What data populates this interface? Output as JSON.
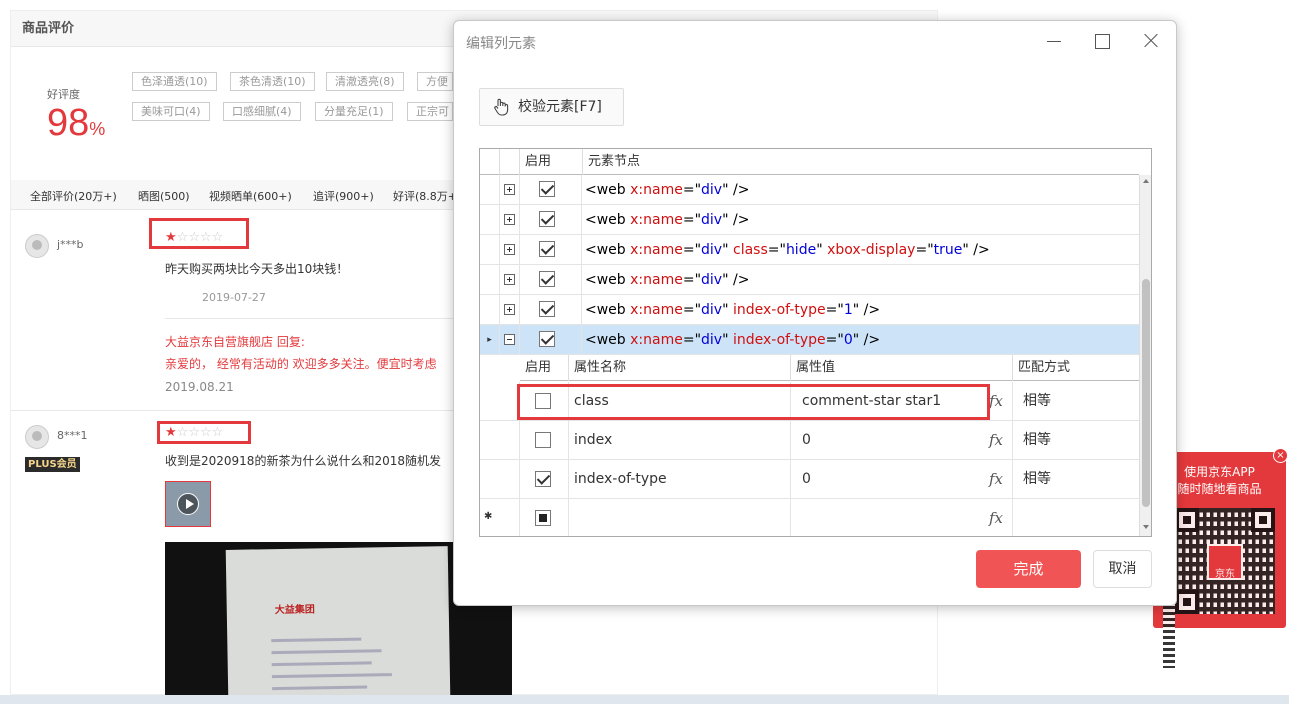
{
  "page": {
    "section_title": "商品评价",
    "good_rate_label": "好评度",
    "good_rate_value": "98",
    "good_rate_unit": "%",
    "tags": [
      "色泽通透(10)",
      "茶色清透(10)",
      "清澈透亮(8)",
      "方便",
      "美味可口(4)",
      "口感细腻(4)",
      "分量充足(1)",
      "正宗可"
    ],
    "filters": [
      "全部评价(20万+)",
      "晒图(500)",
      "视频晒单(600+)",
      "追评(900+)",
      "好评(8.8万+"
    ],
    "reviews": [
      {
        "user": "j***b",
        "stars": "★☆☆☆☆",
        "text": "昨天购买两块比今天多出10块钱！",
        "date": "2019-07-27",
        "reply_header": "大益京东自营旗舰店 回复:",
        "reply_text": "亲爱的， 经常有活动的 欢迎多多关注。便宜时考虑",
        "reply_date": "2019.08.21"
      },
      {
        "user": "8***1",
        "badge": "PLUS会员",
        "stars": "★☆☆☆☆",
        "text": "收到是2020918的新茶为什么说什么和2018随机发"
      }
    ],
    "video_brand": "大益集团"
  },
  "app_ad": {
    "line1": "使用京东APP",
    "line2": "随时随地看商品",
    "logo_text": "京东",
    "close_icon": "×"
  },
  "dialog": {
    "title": "编辑列元素",
    "verify_button": "校验元素[F7]",
    "grid": {
      "headers": {
        "enabled": "启用",
        "node": "元素节点"
      },
      "rows": [
        {
          "expand": "+",
          "checked": true,
          "selected": false,
          "current": false,
          "tag": "web",
          "attrs": [
            {
              "n": "x:name",
              "v": "div"
            }
          ]
        },
        {
          "expand": "+",
          "checked": true,
          "selected": false,
          "current": false,
          "tag": "web",
          "attrs": [
            {
              "n": "x:name",
              "v": "div"
            }
          ]
        },
        {
          "expand": "+",
          "checked": true,
          "selected": false,
          "current": false,
          "tag": "web",
          "attrs": [
            {
              "n": "x:name",
              "v": "div"
            },
            {
              "n": "class",
              "v": "hide"
            },
            {
              "n": "xbox-display",
              "v": "true"
            }
          ]
        },
        {
          "expand": "+",
          "checked": true,
          "selected": false,
          "current": false,
          "tag": "web",
          "attrs": [
            {
              "n": "x:name",
              "v": "div"
            }
          ]
        },
        {
          "expand": "+",
          "checked": true,
          "selected": false,
          "current": false,
          "tag": "web",
          "attrs": [
            {
              "n": "x:name",
              "v": "div"
            },
            {
              "n": "index-of-type",
              "v": "1"
            }
          ]
        },
        {
          "expand": "-",
          "checked": true,
          "selected": true,
          "current": true,
          "tag": "web",
          "attrs": [
            {
              "n": "x:name",
              "v": "div"
            },
            {
              "n": "index-of-type",
              "v": "0"
            }
          ]
        }
      ],
      "sub_headers": {
        "enabled": "启用",
        "attr_name": "属性名称",
        "attr_value": "属性值",
        "match": "匹配方式"
      },
      "sub_rows": [
        {
          "checked": false,
          "name": "class",
          "value": "comment-star star1",
          "fx": "fx",
          "match": "相等"
        },
        {
          "checked": false,
          "name": "index",
          "value": "0",
          "fx": "fx",
          "match": "相等"
        },
        {
          "checked": true,
          "name": "index-of-type",
          "value": "0",
          "fx": "fx",
          "match": "相等"
        },
        {
          "checked": "indeterminate",
          "name": "",
          "value": "",
          "fx": "fx",
          "match": "",
          "marker": "✱"
        }
      ],
      "current_row_marker": "▸"
    },
    "done_button": "完成",
    "cancel_button": "取消"
  }
}
